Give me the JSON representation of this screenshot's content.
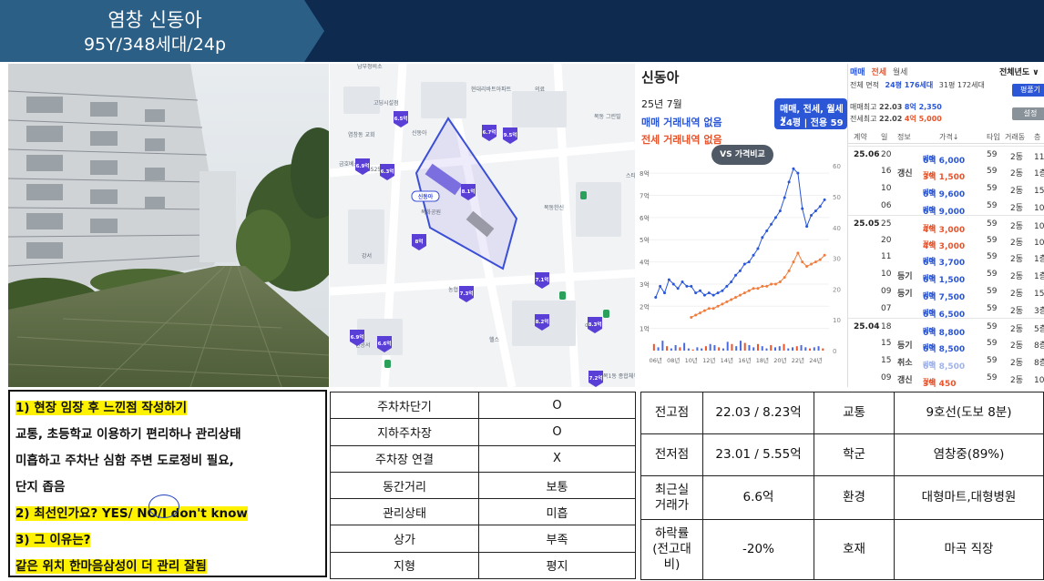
{
  "header": {
    "title": "염창 신동아",
    "subtitle": "95Y/348세대/24p",
    "bg_color": "#0e2a4f"
  },
  "map": {
    "labels": [
      "남부정비소",
      "고딩시설점",
      "염창동 교회",
      "현대리바트아파트",
      "신동아",
      "의료",
      "금호베스트",
      "GS25",
      "목동한신",
      "목화공원",
      "목동 그린빌",
      "강서",
      "헬스",
      "스타벅스",
      "농협",
      "이마트",
      "관공서",
      "목1동 종합체육관"
    ],
    "price_pins": [
      "6.5억",
      "6.9억",
      "6.3억",
      "9.5억",
      "6.7억",
      "8.1억",
      "8억",
      "6.9억",
      "7.1억",
      "8.2억",
      "7.3억",
      "8.3억",
      "6.6억",
      "7.2억"
    ],
    "target_pin": "신동아",
    "pin_color": "#5a3fd6"
  },
  "chart_panel": {
    "complex_name": "신동아",
    "month": "25년 7월",
    "sale_status": "매매 거래내역 없음",
    "lease_status": "전세 거래내역 없음",
    "type_line1": "매매, 전세, 월세 ∨",
    "type_line2": "24평 | 전용 59㎡",
    "compare_button": "VS 가격비교"
  },
  "chart_data": {
    "type": "line",
    "x_ticks": [
      "06년",
      "08년",
      "10년",
      "12년",
      "14년",
      "16년",
      "18년",
      "20년",
      "22년",
      "24년"
    ],
    "y_ticks_left": [
      "1억",
      "2억",
      "3억",
      "4억",
      "5억",
      "6억",
      "7억",
      "8억"
    ],
    "y_ticks_right": [
      "0",
      "10",
      "20",
      "30",
      "40",
      "50",
      "60"
    ],
    "ylim": [
      0,
      8.5
    ],
    "xlim": [
      2005,
      2025.5
    ],
    "series": [
      {
        "name": "매매",
        "color": "#2b56d6",
        "x": [
          2006,
          2006.5,
          2007,
          2007.5,
          2008,
          2008.5,
          2009,
          2009.5,
          2010,
          2010.5,
          2011,
          2011.5,
          2012,
          2012.5,
          2013,
          2013.5,
          2014,
          2014.5,
          2015,
          2015.5,
          2016,
          2016.5,
          2017,
          2017.5,
          2018,
          2018.5,
          2019,
          2019.5,
          2020,
          2020.5,
          2021,
          2021.5,
          2022,
          2022.5,
          2023,
          2023.5,
          2024,
          2024.5,
          2025
        ],
        "y": [
          2.4,
          2.9,
          2.6,
          3.2,
          3.0,
          2.8,
          3.1,
          2.9,
          2.9,
          2.6,
          2.7,
          2.5,
          2.6,
          2.5,
          2.6,
          2.7,
          2.9,
          3.1,
          3.4,
          3.6,
          3.9,
          4.0,
          4.3,
          4.6,
          5.1,
          5.4,
          5.7,
          6.0,
          6.3,
          6.9,
          7.6,
          8.2,
          8.0,
          6.4,
          5.6,
          6.1,
          6.3,
          6.5,
          6.8
        ]
      },
      {
        "name": "전세",
        "color": "#f07c3c",
        "x": [
          2010,
          2010.5,
          2011,
          2011.5,
          2012,
          2012.5,
          2013,
          2013.5,
          2014,
          2014.5,
          2015,
          2015.5,
          2016,
          2016.5,
          2017,
          2017.5,
          2018,
          2018.5,
          2019,
          2019.5,
          2020,
          2020.5,
          2021,
          2021.5,
          2022,
          2022.5,
          2023,
          2023.5,
          2024,
          2024.5,
          2025
        ],
        "y": [
          1.5,
          1.6,
          1.7,
          1.8,
          1.9,
          1.9,
          2.0,
          2.1,
          2.2,
          2.3,
          2.4,
          2.5,
          2.6,
          2.7,
          2.8,
          2.8,
          2.9,
          2.9,
          3.0,
          3.0,
          3.1,
          3.3,
          3.6,
          4.0,
          4.4,
          4.0,
          3.8,
          3.9,
          4.0,
          4.1,
          4.3
        ]
      }
    ],
    "volume_bars": [
      6,
      3,
      9,
      4,
      2,
      5,
      3,
      7,
      2,
      1,
      3,
      2,
      4,
      6,
      5,
      3,
      2,
      8,
      6,
      4,
      9,
      7,
      5,
      3,
      6,
      4,
      2,
      5,
      3,
      4,
      6,
      2,
      3,
      4,
      5,
      3,
      2,
      3,
      4,
      2
    ]
  },
  "tx_panel": {
    "tabs": [
      "매매",
      "전세",
      "월세"
    ],
    "tab_colors": [
      "#2b56d6",
      "#e8542c",
      "#555555"
    ],
    "year_label": "전체년도 ∨",
    "area_label": "전체 면적",
    "area_24": "24평 176세대",
    "area_31": "31평 172세대",
    "py_button": "평풀기",
    "sale_max_label": "매매최고",
    "sale_max_date": "22.03",
    "sale_max_price": "8억 2,350",
    "lease_max_label": "전세최고",
    "lease_max_date": "22.02",
    "lease_max_price": "4억 5,000",
    "setting_button": "설정",
    "columns": [
      "계약",
      "일",
      "정보",
      "가격↓",
      "타입",
      "거래동",
      "층"
    ],
    "rows": [
      {
        "month": "25.06",
        "day": "20",
        "info": "",
        "kind": "매매",
        "price": "6억 6,000",
        "type": "59",
        "dong": "2동",
        "floor": "11층"
      },
      {
        "month": "",
        "day": "16",
        "info": "갱신",
        "kind": "전세",
        "price": "3억 1,500",
        "type": "59",
        "dong": "2동",
        "floor": "1층"
      },
      {
        "month": "",
        "day": "10",
        "info": "",
        "kind": "매매",
        "price": "6억 9,600",
        "type": "59",
        "dong": "2동",
        "floor": "15층"
      },
      {
        "month": "",
        "day": "06",
        "info": "",
        "kind": "매매",
        "price": "6억 9,000",
        "type": "59",
        "dong": "2동",
        "floor": "10층"
      },
      {
        "month": "25.05",
        "day": "25",
        "info": "",
        "kind": "전세",
        "price": "4억 3,000",
        "type": "59",
        "dong": "2동",
        "floor": "10층"
      },
      {
        "month": "",
        "day": "20",
        "info": "",
        "kind": "전세",
        "price": "4억 3,000",
        "type": "59",
        "dong": "2동",
        "floor": "10층"
      },
      {
        "month": "",
        "day": "11",
        "info": "",
        "kind": "매매",
        "price": "6억 3,700",
        "type": "59",
        "dong": "2동",
        "floor": "1층"
      },
      {
        "month": "",
        "day": "10",
        "info": "등기",
        "kind": "매매",
        "price": "6억 1,500",
        "type": "59",
        "dong": "2동",
        "floor": "1층"
      },
      {
        "month": "",
        "day": "09",
        "info": "등기",
        "kind": "매매",
        "price": "6억 7,500",
        "type": "59",
        "dong": "2동",
        "floor": "15층"
      },
      {
        "month": "",
        "day": "07",
        "info": "",
        "kind": "매매",
        "price": "6억 6,500",
        "type": "59",
        "dong": "2동",
        "floor": "3층"
      },
      {
        "month": "25.04",
        "day": "18",
        "info": "",
        "kind": "매매",
        "price": "6억 8,800",
        "type": "59",
        "dong": "2동",
        "floor": "5층"
      },
      {
        "month": "",
        "day": "15",
        "info": "등기",
        "kind": "매매",
        "price": "6억 8,500",
        "type": "59",
        "dong": "2동",
        "floor": "8층"
      },
      {
        "month": "",
        "day": "15",
        "info": "취소",
        "kind": "매매",
        "price": "6억 8,500",
        "type": "59",
        "dong": "2동",
        "floor": "8층"
      },
      {
        "month": "",
        "day": "09",
        "info": "갱신",
        "kind": "전세",
        "price": "3억 450",
        "type": "59",
        "dong": "2동",
        "floor": "10층"
      }
    ]
  },
  "notes": {
    "q1": "1) 현장 임장 후 느낀점 작성하기",
    "a1_line1": "교통, 초등학교 이용하기 편리하나 관리상태",
    "a1_line2": "미흡하고 주차난 심함 주변 도로정비 필요,",
    "a1_line3": "단지 좁음",
    "q2_prefix": "2) 최선인가요? YES/",
    "q2_no": " NO",
    "q2_suffix": "/I don't know",
    "q3": "3) 그 이유는?",
    "a3": "같은 위치 한마음삼성이 더 관리 잘됨",
    "highlight_color": "#fff200"
  },
  "facility_table": [
    {
      "label": "주차차단기",
      "value": "O"
    },
    {
      "label": "지하주차장",
      "value": "O"
    },
    {
      "label": "주차장 연결",
      "value": "X"
    },
    {
      "label": "동간거리",
      "value": "보통"
    },
    {
      "label": "관리상태",
      "value": "미흡"
    },
    {
      "label": "상가",
      "value": "부족"
    },
    {
      "label": "지형",
      "value": "평지"
    }
  ],
  "info_table": [
    {
      "k1": "전고점",
      "v1": "22.03 / 8.23억",
      "k2": "교통",
      "v2": "9호선(도보 8분)"
    },
    {
      "k1": "전저점",
      "v1": "23.01 / 5.55억",
      "k2": "학군",
      "v2": "염창중(89%)"
    },
    {
      "k1": "최근실\n거래가",
      "v1": "6.6억",
      "k2": "환경",
      "v2": "대형마트,대형병원"
    },
    {
      "k1": "하락률\n(전고대\n비)",
      "v1": "-20%",
      "k2": "호재",
      "v2": "마곡 직장"
    }
  ]
}
